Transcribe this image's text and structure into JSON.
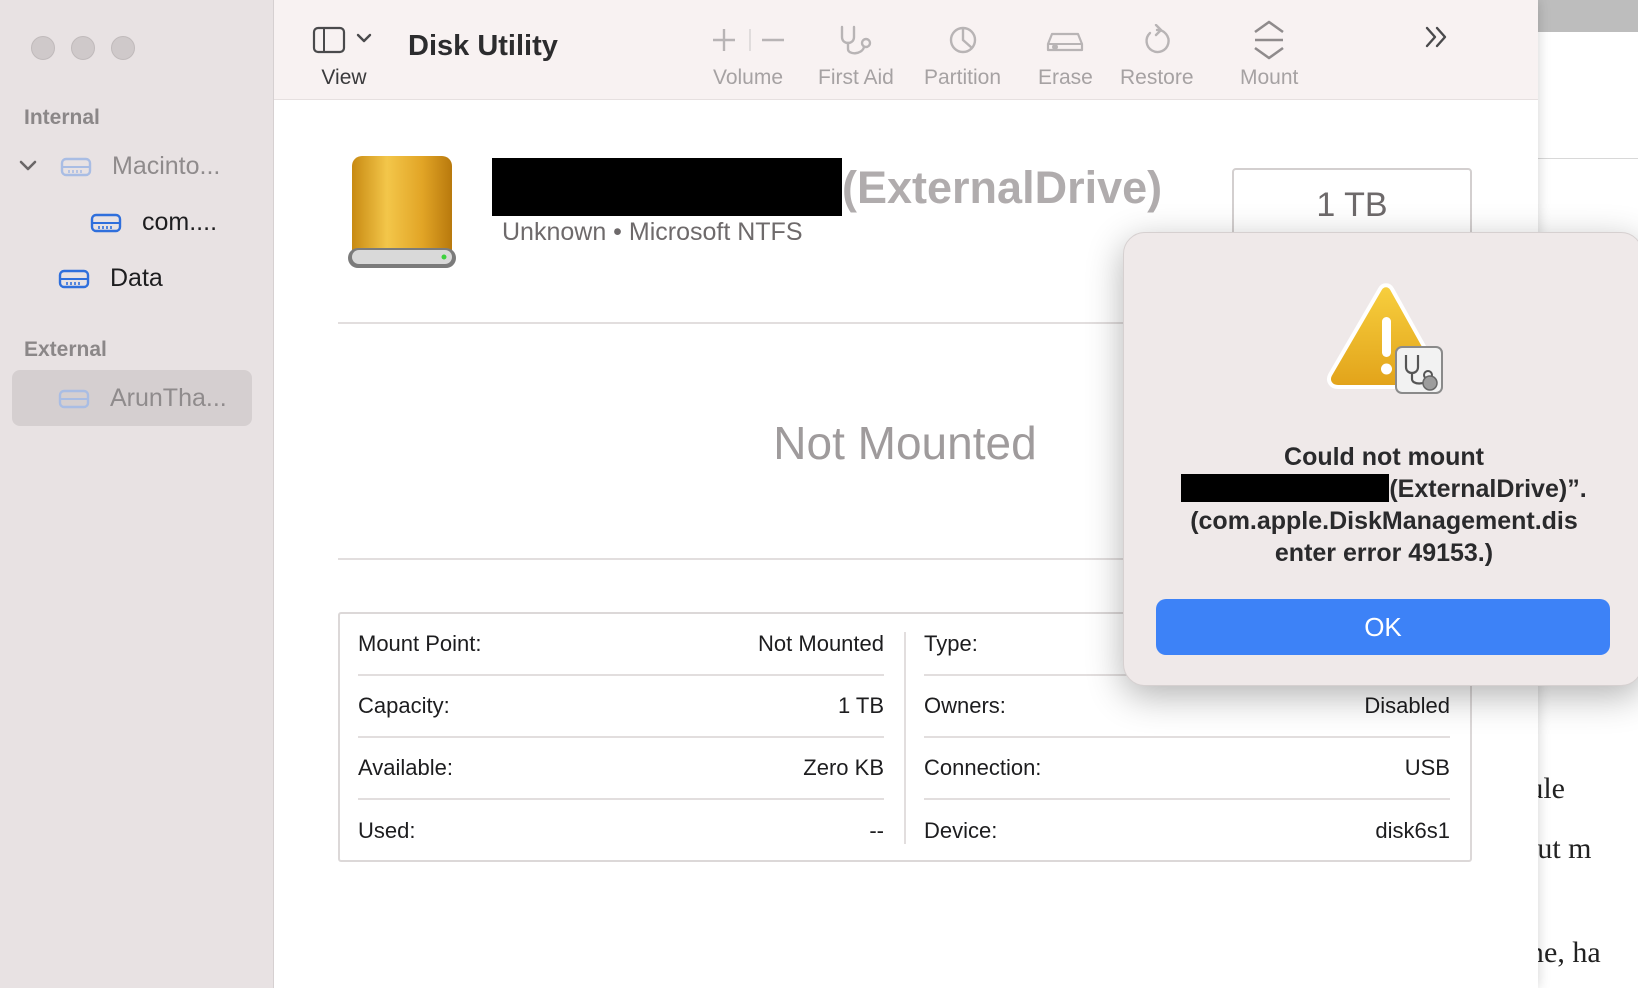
{
  "window": {
    "title": "Disk Utility"
  },
  "sidebar": {
    "sections": [
      {
        "label": "Internal"
      },
      {
        "label": "External"
      }
    ],
    "items": [
      {
        "label": "Macinto..."
      },
      {
        "label": "com...."
      },
      {
        "label": "Data"
      },
      {
        "label": "ArunTha..."
      }
    ]
  },
  "toolbar": {
    "view_label": "View",
    "volume_label": "Volume",
    "first_aid_label": "First Aid",
    "partition_label": "Partition",
    "erase_label": "Erase",
    "restore_label": "Restore",
    "mount_label": "Mount"
  },
  "drive": {
    "name": "(ExternalDrive)",
    "subtitle": "Unknown • Microsoft NTFS",
    "capacity": "1 TB",
    "status": "Not Mounted"
  },
  "info": {
    "left": [
      {
        "label": "Mount Point:",
        "value": "Not Mounted"
      },
      {
        "label": "Capacity:",
        "value": "1 TB"
      },
      {
        "label": "Available:",
        "value": "Zero KB"
      },
      {
        "label": "Used:",
        "value": "--"
      }
    ],
    "right": [
      {
        "label": "Type:",
        "value": ""
      },
      {
        "label": "Owners:",
        "value": "Disabled"
      },
      {
        "label": "Connection:",
        "value": "USB"
      },
      {
        "label": "Device:",
        "value": "disk6s1"
      }
    ]
  },
  "alert": {
    "line1": "Could not mount",
    "line2": "(ExternalDrive)”.",
    "line3": "(com.apple.DiskManagement.dis",
    "line4": "enter error 49153.)",
    "ok_label": "OK"
  },
  "background_doc": {
    "lines": [
      "edule",
      "about m",
      "time, ha"
    ]
  },
  "colors": {
    "accent": "#3d82f7",
    "sidebar_bg": "#e8e2e3",
    "toolbar_bg": "#f8f2f2",
    "sidebar_icon": "#2f6fdc",
    "drive_gold": "#e2a526"
  }
}
